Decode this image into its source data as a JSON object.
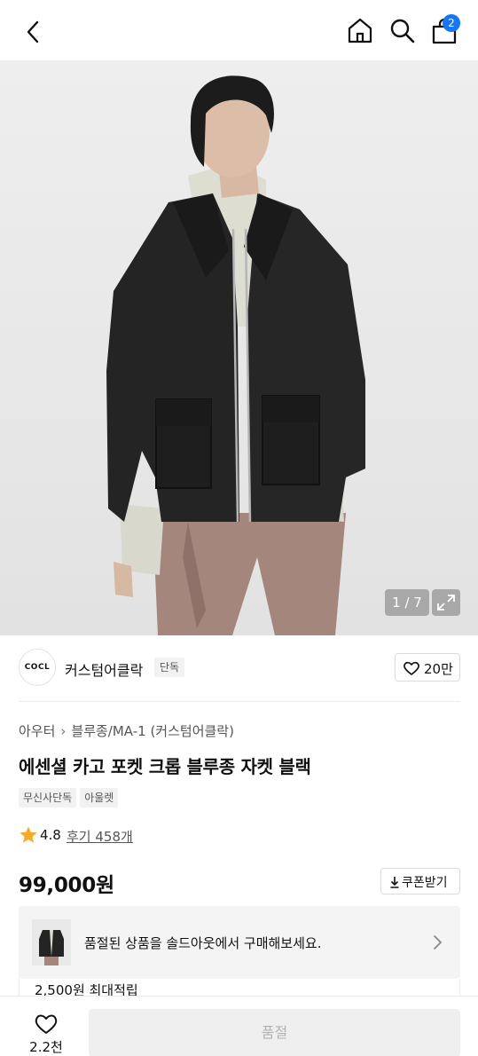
{
  "header": {
    "cart_count": "2"
  },
  "gallery": {
    "counter": "1 / 7"
  },
  "brand": {
    "logo_text": "COCL",
    "name": "커스텀어클락",
    "badge": "단독",
    "likes": "20만"
  },
  "product": {
    "breadcrumb": [
      "아우터",
      "블루종/MA-1 (커스텀어클락)"
    ],
    "title": "에센셜 카고 포켓 크롭 블루종 자켓 블랙",
    "tags": [
      "무신사단독",
      "아울렛"
    ],
    "rating": "4.8",
    "reviews": "후기 458개",
    "rating_color": "#f7a928",
    "price": "99,000원",
    "coupon_label": "쿠폰받기"
  },
  "soldout_banner": {
    "message": "품절된 상품을 솔드아웃에서 구매해보세요."
  },
  "points": {
    "text": "2,500원 최대적립"
  },
  "bottom": {
    "wish_count": "2.2천",
    "action_label": "품절"
  },
  "colors": {
    "accent": "#1777f2",
    "disabled_bg": "#efefef",
    "disabled_text": "#b3b3b3"
  }
}
